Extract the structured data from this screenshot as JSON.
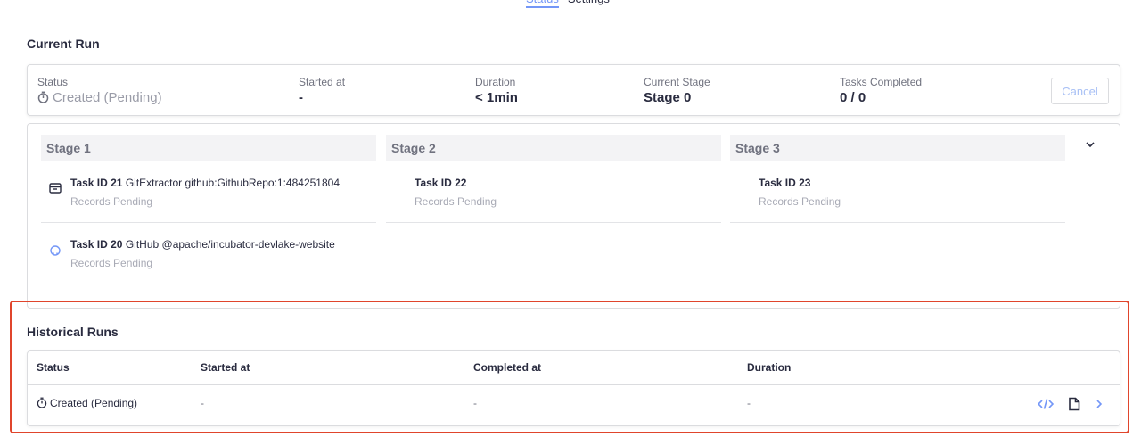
{
  "top_tabs": {
    "status": "Status",
    "settings": "Settings"
  },
  "current_run": {
    "title": "Current Run",
    "status_label": "Status",
    "status_value": "Created (Pending)",
    "started_label": "Started at",
    "started_value": "-",
    "duration_label": "Duration",
    "duration_value": "< 1min",
    "stage_label": "Current Stage",
    "stage_value": "Stage 0",
    "tasks_label": "Tasks Completed",
    "tasks_value": "0 / 0",
    "cancel_label": "Cancel"
  },
  "stages": [
    {
      "name": "Stage 1",
      "tasks": [
        {
          "id": "Task ID 21",
          "desc": "GitExtractor github:GithubRepo:1:484251804",
          "status": "Records Pending",
          "icon": "package-icon"
        },
        {
          "id": "Task ID 20",
          "desc": "GitHub @apache/incubator-devlake-website",
          "status": "Records Pending",
          "icon": "github-icon"
        }
      ]
    },
    {
      "name": "Stage 2",
      "tasks": [
        {
          "id": "Task ID 22",
          "desc": "",
          "status": "Records Pending"
        }
      ]
    },
    {
      "name": "Stage 3",
      "tasks": [
        {
          "id": "Task ID 23",
          "desc": "",
          "status": "Records Pending"
        }
      ]
    }
  ],
  "historical_runs": {
    "title": "Historical Runs",
    "columns": {
      "status": "Status",
      "started": "Started at",
      "completed": "Completed at",
      "duration": "Duration"
    },
    "rows": [
      {
        "status": "Created (Pending)",
        "started": "-",
        "completed": "-",
        "duration": "-"
      }
    ]
  },
  "colors": {
    "accent": "#7497f7",
    "highlight_border": "#e0452c",
    "text": "#292b3f",
    "muted": "#70727f"
  }
}
